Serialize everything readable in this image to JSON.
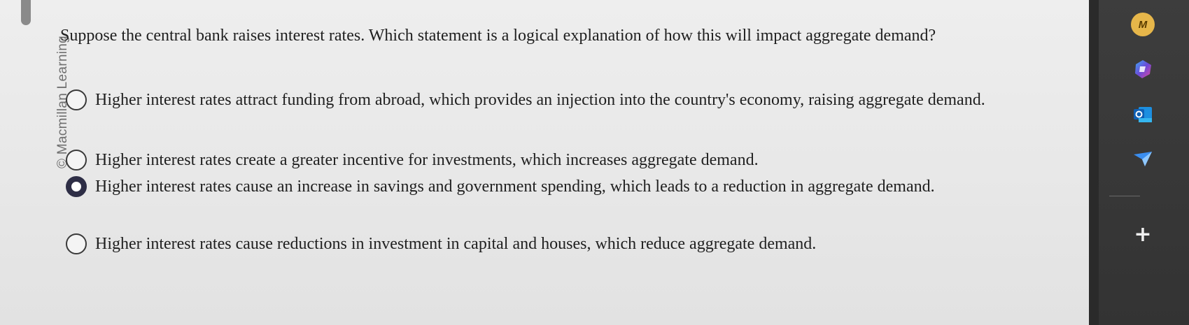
{
  "watermark": "© Macmillan Learning",
  "question": "Suppose the central bank raises interest rates. Which statement is a logical explanation of how this will impact aggregate demand?",
  "options": [
    {
      "text": "Higher interest rates attract funding from abroad, which provides an injection into the country's economy, raising aggregate demand.",
      "selected": false
    },
    {
      "text": "Higher interest rates create a greater incentive for investments, which increases aggregate demand.",
      "selected": false
    },
    {
      "text": "Higher interest rates cause an increase in savings and government spending, which leads to a reduction in aggregate demand.",
      "selected": true
    },
    {
      "text": "Higher interest rates cause reductions in investment in capital and houses, which reduce aggregate demand.",
      "selected": false
    }
  ],
  "sidebar": {
    "icons": [
      "macmillan-icon",
      "copilot-icon",
      "outlook-icon",
      "send-icon",
      "plus-icon"
    ],
    "m_label": "M",
    "plus_label": "+"
  },
  "colors": {
    "selected_radio": "#2e2e46",
    "sidebar_bg": "#3d3d3d",
    "accent_m": "#e6b64a"
  }
}
